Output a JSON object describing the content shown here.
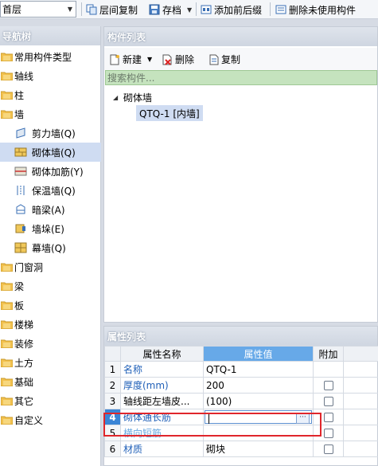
{
  "toolbar": {
    "floor": "首层",
    "copy_between_floors": "层间复制",
    "save_archive": "存档",
    "add_prefix_suffix": "添加前后缀",
    "delete_unused": "删除未使用构件"
  },
  "nav": {
    "title": "导航树",
    "items": [
      {
        "label": "常用构件类型",
        "level": 0
      },
      {
        "label": "轴线",
        "level": 0
      },
      {
        "label": "柱",
        "level": 0
      },
      {
        "label": "墙",
        "level": 0
      },
      {
        "label": "剪力墙(Q)",
        "level": 1,
        "icon": "shear-wall-icon"
      },
      {
        "label": "砌体墙(Q)",
        "level": 1,
        "icon": "masonry-wall-icon",
        "selected": true
      },
      {
        "label": "砌体加筋(Y)",
        "level": 1,
        "icon": "masonry-reinforcement-icon"
      },
      {
        "label": "保温墙(Q)",
        "level": 1,
        "icon": "insulation-wall-icon"
      },
      {
        "label": "暗梁(A)",
        "level": 1,
        "icon": "hidden-beam-icon"
      },
      {
        "label": "墙垛(E)",
        "level": 1,
        "icon": "wall-pier-icon"
      },
      {
        "label": "幕墙(Q)",
        "level": 1,
        "icon": "curtain-wall-icon"
      },
      {
        "label": "门窗洞",
        "level": 0
      },
      {
        "label": "梁",
        "level": 0
      },
      {
        "label": "板",
        "level": 0
      },
      {
        "label": "楼梯",
        "level": 0
      },
      {
        "label": "装修",
        "level": 0
      },
      {
        "label": "土方",
        "level": 0
      },
      {
        "label": "基础",
        "level": 0
      },
      {
        "label": "其它",
        "level": 0
      },
      {
        "label": "自定义",
        "level": 0
      }
    ]
  },
  "component_list": {
    "title": "构件列表",
    "new_label": "新建",
    "delete_label": "删除",
    "copy_label": "复制",
    "search_placeholder": "搜索构件...",
    "tree_root": "砌体墙",
    "tree_leaf": "QTQ-1 [内墙]"
  },
  "property_list": {
    "title": "属性列表",
    "headers": [
      "属性名称",
      "属性值",
      "附加"
    ],
    "rows": [
      {
        "num": "1",
        "name": "名称",
        "value": "QTQ-1"
      },
      {
        "num": "2",
        "name": "厚度(mm)",
        "value": "200"
      },
      {
        "num": "3",
        "name": "轴线距左墙皮...",
        "value": "(100)"
      },
      {
        "num": "4",
        "name": "砌体通长筋",
        "value": ""
      },
      {
        "num": "5",
        "name": "横向短筋",
        "value": ""
      },
      {
        "num": "6",
        "name": "材质",
        "value": "砌块"
      }
    ]
  },
  "colors": {
    "accent": "#67a9e8",
    "highlight_frame": "#e0262b",
    "selection": "#cfdcf2",
    "search_bg": "#c5e3be"
  }
}
